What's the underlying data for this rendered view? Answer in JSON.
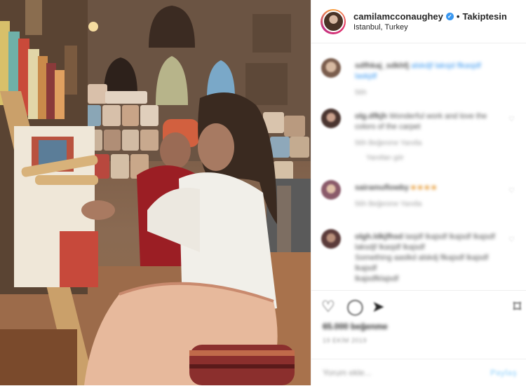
{
  "header": {
    "username": "camilamcconaughey",
    "follow_label": "Takiptesin",
    "location": "Istanbul, Turkey",
    "verified_icon": "verified-badge-icon"
  },
  "comments": [
    {
      "user": "sdfhkaj_sdkhfj",
      "text": "alskdjf laksjd flkasjdf laskjdf",
      "meta": "56h"
    },
    {
      "user": "olg.dfkjh",
      "text": "Wonderful work and love the colors of the carpet",
      "meta": "56h   Beğenme   Yanıtla",
      "extra": "Yanıtları gör"
    },
    {
      "user": "sairamuflowby",
      "text": "",
      "meta": "56h   Beğenme   Yanıtla"
    },
    {
      "user": "olgh.ldkjfhsd",
      "text": "lasjdf lkajsdf lkajsdf lkajsdf laksdjf lkasjdf lkajsdf",
      "text2": "Something aaslkd alskdj flkajsdf lkajsdf lkajsdf",
      "text3": "lkajsdfklajsdf",
      "meta": ""
    }
  ],
  "likes_text": "65.000 beğenme",
  "date_text": "19 EKİM 2019",
  "add_comment_placeholder": "Yorum ekle...",
  "post_button": "Paylaş",
  "colors": {
    "verified": "#3897f0",
    "border": "#efefef",
    "text": "#262626",
    "muted": "#999999",
    "post_button": "#b2dffc"
  }
}
